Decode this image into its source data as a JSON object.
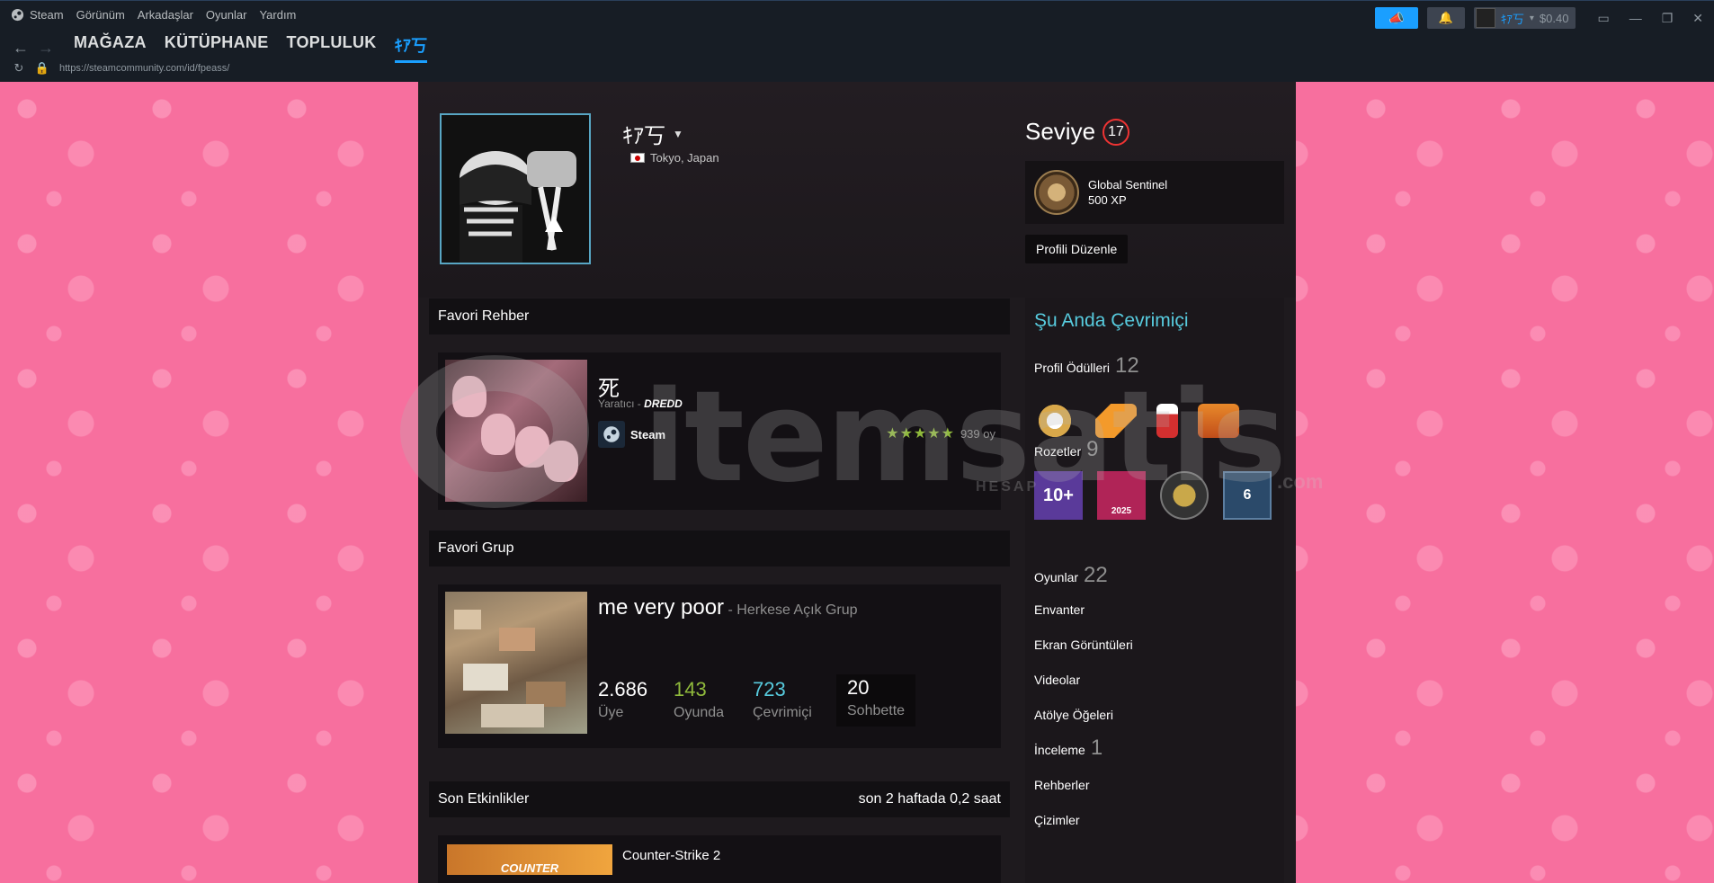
{
  "menu": {
    "steam": "Steam",
    "items": [
      "Görünüm",
      "Arkadaşlar",
      "Oyunlar",
      "Yardım"
    ]
  },
  "nav": {
    "tabs": [
      "MAĞAZA",
      "KÜTÜPHANE",
      "TOPLULUK",
      "ｷｱ丂"
    ]
  },
  "url": "https://steamcommunity.com/id/fpeass/",
  "account": {
    "name": "ｷｱ丂",
    "balance": "$0.40"
  },
  "profile": {
    "name": "ｷｱ丂",
    "location": "Tokyo, Japan",
    "level_label": "Seviye",
    "level": "17",
    "xp_badge_name": "Global Sentinel",
    "xp": "500 XP",
    "edit_button": "Profili Düzenle"
  },
  "favorite_guide": {
    "header": "Favori Rehber",
    "title": "死",
    "author_prefix": "Yaratıcı - ",
    "author": "DREDD",
    "app": "Steam",
    "stars": "★★★★★",
    "votes": "939 oy"
  },
  "favorite_group": {
    "header": "Favori Grup",
    "name": "me very poor",
    "type": " - Herkese Açık Grup",
    "members": "2.686",
    "members_label": "Üye",
    "in_game": "143",
    "in_game_label": "Oyunda",
    "online": "723",
    "online_label": "Çevrimiçi",
    "in_chat": "20",
    "in_chat_label": "Sohbette"
  },
  "recent_activity": {
    "header": "Son Etkinlikler",
    "summary": "son 2 haftada 0,2 saat",
    "game": "Counter-Strike 2",
    "game_capsule": "COUNTER"
  },
  "right": {
    "status": "Şu Anda Çevrimiçi",
    "awards_label": "Profil Ödülleri",
    "awards_count": "12",
    "badges_label": "Rozetler",
    "badges_count": "9",
    "badge_10": "10+",
    "badge_year": "2025",
    "badge_6": "6",
    "games_label": "Oyunlar",
    "games_count": "22",
    "inventory": "Envanter",
    "screenshots": "Ekran Görüntüleri",
    "videos": "Videolar",
    "workshop": "Atölye Öğeleri",
    "reviews_label": "İnceleme",
    "reviews_count": "1",
    "guides": "Rehberler",
    "artwork": "Çizimler"
  },
  "watermark": {
    "brand": "itemsatis",
    "tagline": "HESAP",
    "domain": ".com"
  },
  "colors": {
    "accent": "#1a9fff",
    "background_pink": "#f76f9e",
    "online": "#57cbde",
    "in_game": "#90ba3c"
  }
}
